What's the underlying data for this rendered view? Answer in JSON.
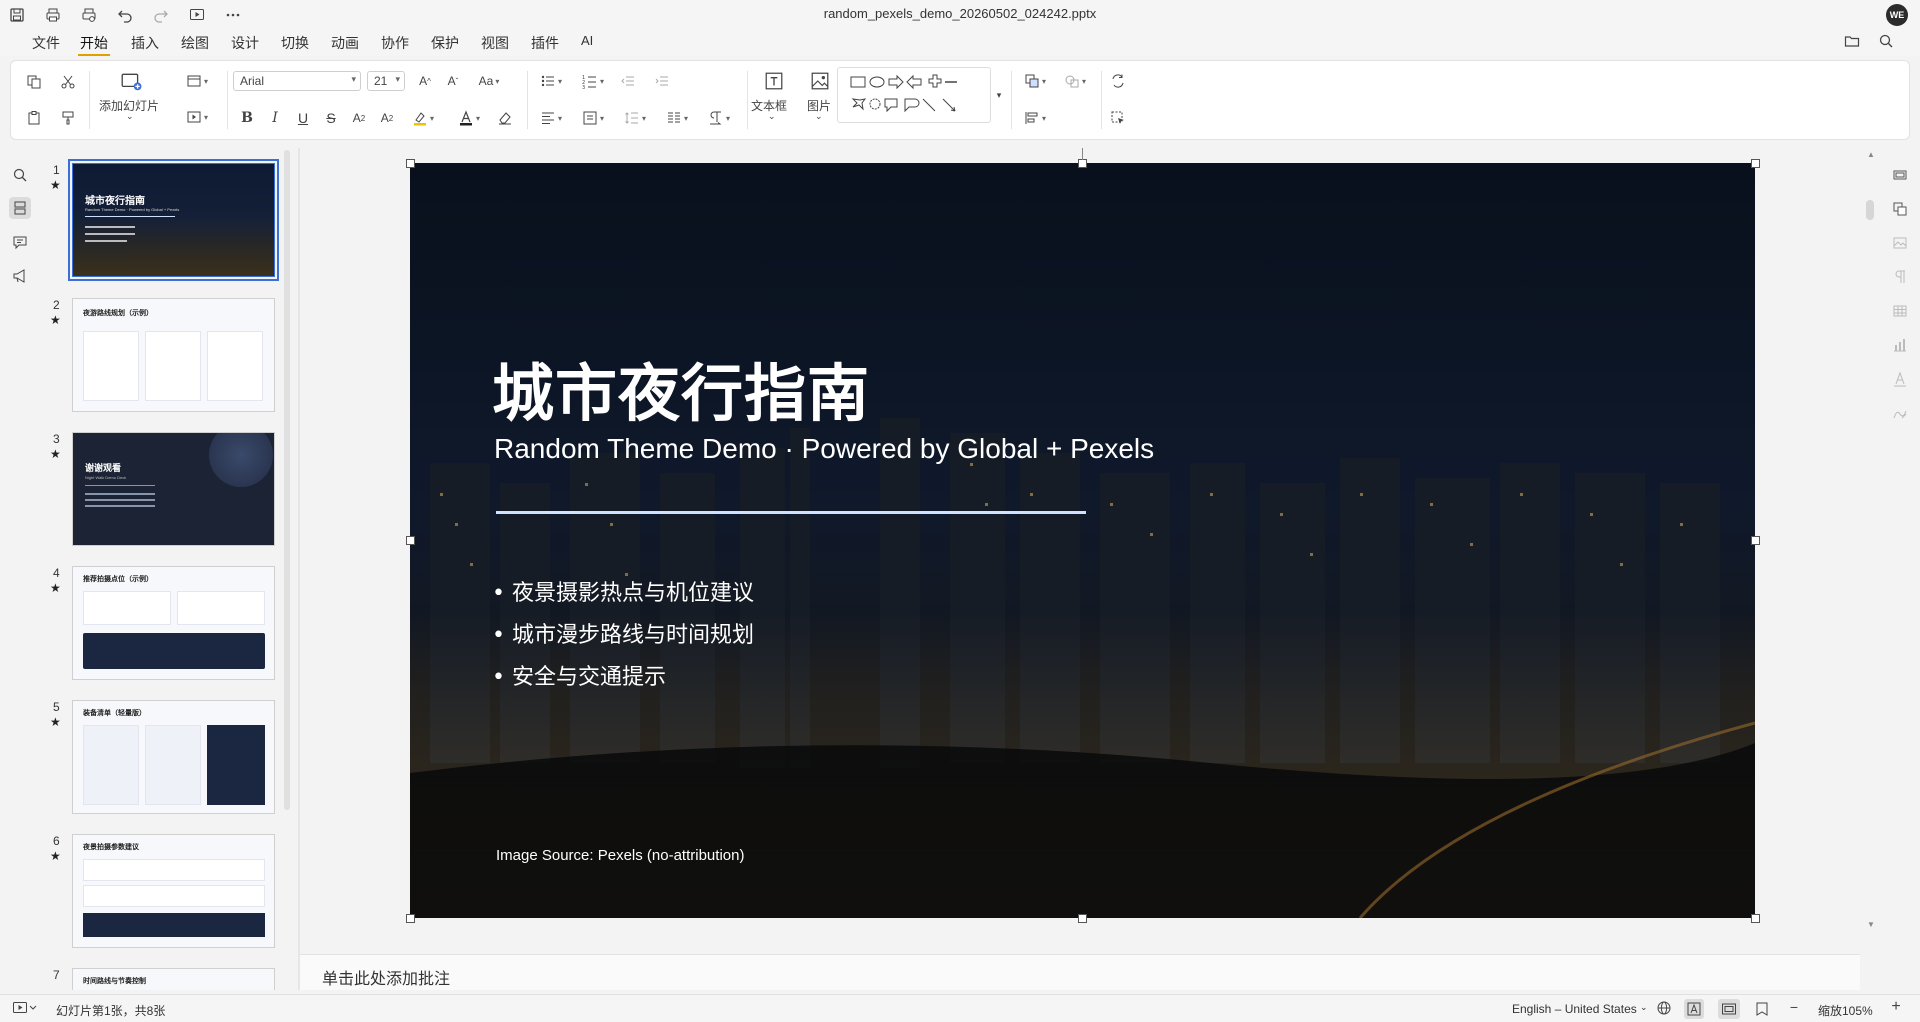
{
  "window": {
    "title": "random_pexels_demo_20260502_024242.pptx",
    "user_initials": "WE"
  },
  "quick_access": [
    "save-icon",
    "print-icon",
    "print-preview-icon",
    "undo-icon",
    "redo-icon",
    "slideshow-icon",
    "more-icon"
  ],
  "menu": {
    "items": [
      "文件",
      "开始",
      "插入",
      "绘图",
      "设计",
      "切换",
      "动画",
      "协作",
      "保护",
      "视图",
      "插件",
      "AI"
    ],
    "active": "开始"
  },
  "ribbon": {
    "add_slide_label": "添加幻灯片",
    "font_name": "Arial",
    "font_size": "21",
    "textbox_label": "文本框",
    "picture_label": "图片"
  },
  "thumbnails": [
    {
      "num": "1",
      "title": "城市夜行指南",
      "subtitle": "Random Theme Demo · Powered by Global + Pexels",
      "style": "dark-photo"
    },
    {
      "num": "2",
      "title": "夜游路线规划（示例）",
      "style": "light-cards"
    },
    {
      "num": "3",
      "title": "谢谢观看",
      "subtitle": "Night Walk Demo Deck",
      "style": "dark"
    },
    {
      "num": "4",
      "title": "推荐拍摄点位（示例）",
      "style": "light-cards-dark-box"
    },
    {
      "num": "5",
      "title": "装备清单（轻量版）",
      "style": "light-three-col"
    },
    {
      "num": "6",
      "title": "夜景拍摄参数建议",
      "style": "light-rows"
    },
    {
      "num": "7",
      "title": "时间路线与节奏控制",
      "style": "light"
    }
  ],
  "slide": {
    "title": "城市夜行指南",
    "subtitle": "Random Theme Demo · Powered by Global  + Pexels",
    "bullets": [
      "• 夜景摄影热点与机位建议",
      "• 城市漫步路线与时间规划",
      "• 安全与交通提示"
    ],
    "source": "Image Source: Pexels (no-attribution)"
  },
  "notes": {
    "placeholder": "单击此处添加批注"
  },
  "status": {
    "slide_info": "幻灯片第1张，共8张",
    "language": "English – United States",
    "zoom": "缩放105%"
  },
  "colors": {
    "accent": "#e0a000",
    "selection": "#3a6fd8",
    "slide_bg": "#0f1726"
  }
}
